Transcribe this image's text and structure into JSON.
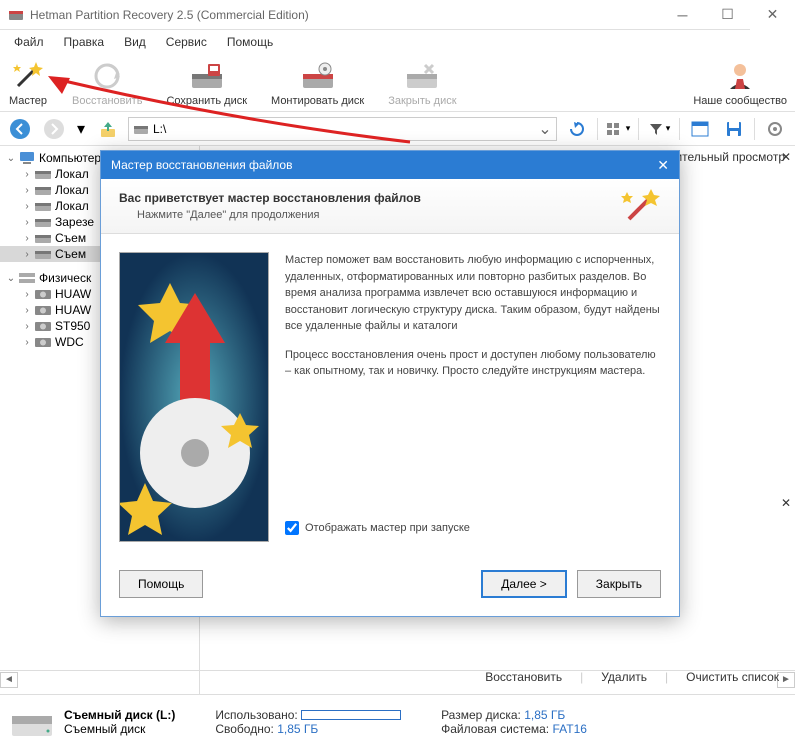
{
  "titlebar": {
    "title": "Hetman Partition Recovery 2.5 (Commercial Edition)"
  },
  "menu": {
    "file": "Файл",
    "edit": "Правка",
    "view": "Вид",
    "service": "Сервис",
    "help": "Помощь"
  },
  "toolbar": {
    "wizard": "Мастер",
    "recover": "Восстановить",
    "save_disk": "Сохранить диск",
    "mount_disk": "Монтировать диск",
    "close_disk": "Закрыть диск",
    "community": "Наше сообщество"
  },
  "address": {
    "path": "L:\\"
  },
  "preview": {
    "title": "Предварительный просмотр"
  },
  "tree": {
    "computer": "Компьютер",
    "items": [
      "Локал",
      "Локал",
      "Локал",
      "Зарезе",
      "Съем",
      "Съем"
    ],
    "physical": "Физическ",
    "drives": [
      "HUAW",
      "HUAW",
      "ST950",
      "WDC"
    ]
  },
  "actions": {
    "recover": "Восстановить",
    "delete": "Удалить",
    "clear": "Очистить список"
  },
  "status": {
    "disk_name": "Съемный диск (L:)",
    "disk_type": "Съемный диск",
    "used_label": "Использовано:",
    "free_label": "Свободно:",
    "free_val": "1,85 ГБ",
    "size_label": "Размер диска:",
    "size_val": "1,85 ГБ",
    "fs_label": "Файловая система:",
    "fs_val": "FAT16"
  },
  "wizard": {
    "title": "Мастер восстановления файлов",
    "h1": "Вас приветствует мастер восстановления файлов",
    "h2": "Нажмите \"Далее\" для продолжения",
    "p1": "Мастер поможет вам восстановить любую информацию с испорченных, удаленных, отформатированных или повторно разбитых разделов. Во время анализа программа извлечет всю оставшуюся информацию и восстановит логическую структуру диска. Таким образом, будут найдены все удаленные файлы и каталоги",
    "p2": "Процесс восстановления очень прост и доступен любому пользователю – как опытному, так и новичку. Просто следуйте инструкциям мастера.",
    "checkbox": "Отображать мастер при запуске",
    "help": "Помощь",
    "next": "Далее >",
    "close": "Закрыть"
  }
}
